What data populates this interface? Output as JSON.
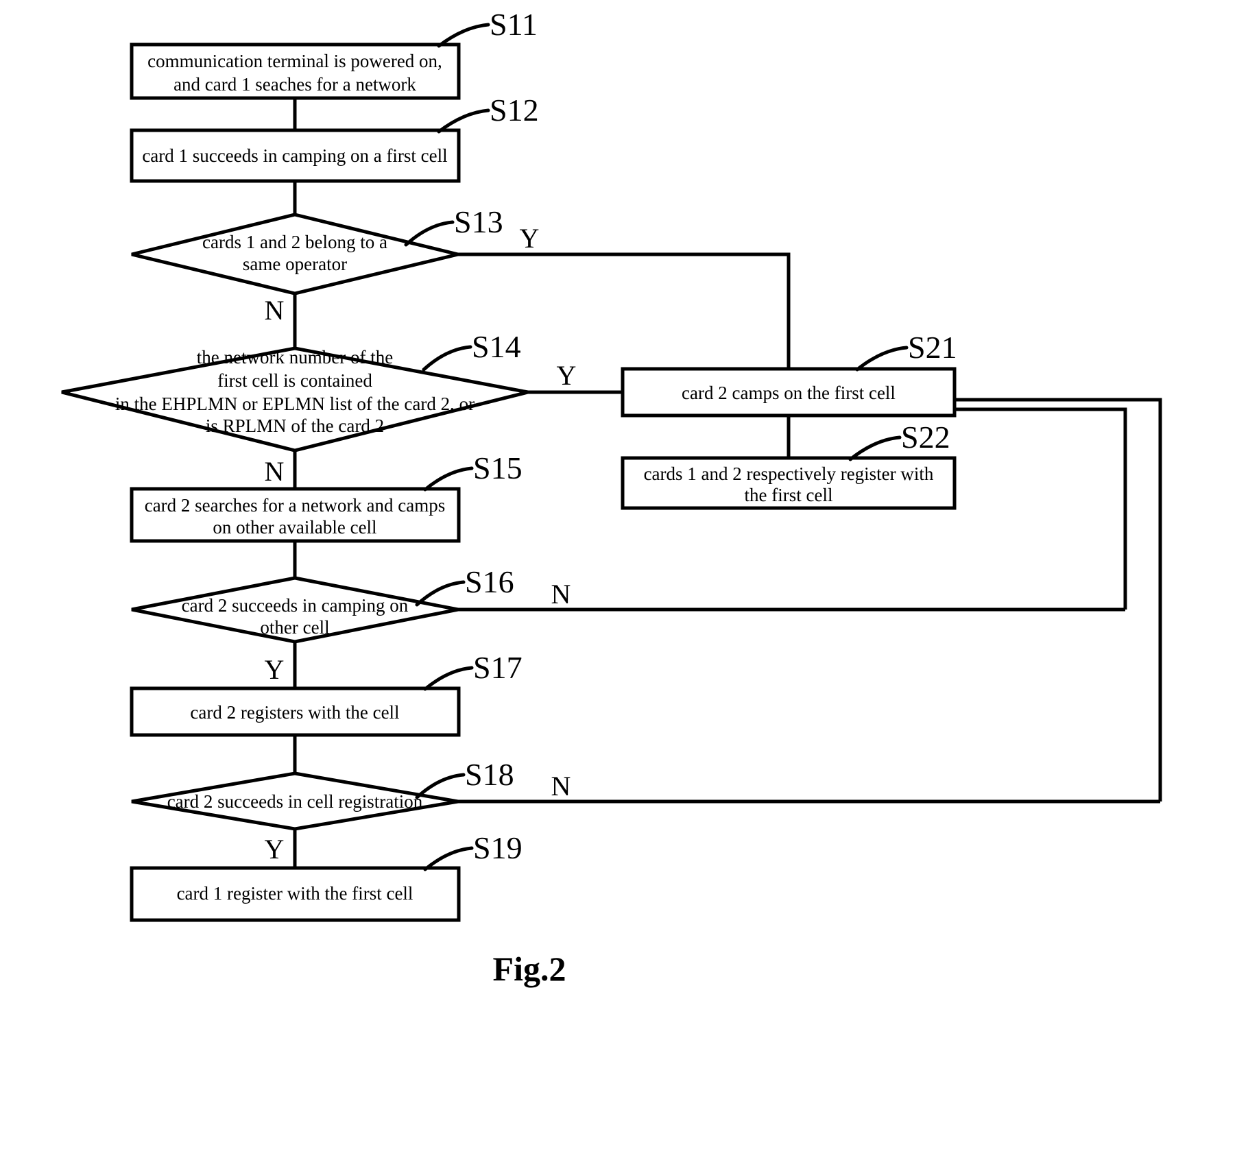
{
  "figure": {
    "caption": "Fig.2",
    "type": "flowchart"
  },
  "nodes": {
    "s11": {
      "id": "S11",
      "shape": "process",
      "lines": [
        "communication terminal is powered on,",
        "and card 1 seaches for a network"
      ]
    },
    "s12": {
      "id": "S12",
      "shape": "process",
      "lines": [
        "card 1 succeeds in camping on a first cell"
      ]
    },
    "s13": {
      "id": "S13",
      "shape": "decision",
      "lines": [
        "cards 1 and 2 belong to a",
        "same operator"
      ]
    },
    "s14": {
      "id": "S14",
      "shape": "decision",
      "lines": [
        "the network number of the",
        "first cell is contained",
        "in the EHPLMN or EPLMN list of the card 2, or",
        "is RPLMN of the card 2"
      ]
    },
    "s15": {
      "id": "S15",
      "shape": "process",
      "lines": [
        "card 2 searches for a network and camps",
        "on other available cell"
      ]
    },
    "s16": {
      "id": "S16",
      "shape": "decision",
      "lines": [
        "card 2 succeeds in camping on",
        "other cell"
      ]
    },
    "s17": {
      "id": "S17",
      "shape": "process",
      "lines": [
        "card 2 registers with the cell"
      ]
    },
    "s18": {
      "id": "S18",
      "shape": "decision",
      "lines": [
        "card 2 succeeds in  cell registration"
      ]
    },
    "s19": {
      "id": "S19",
      "shape": "process",
      "lines": [
        "card 1 register with the first cell"
      ]
    },
    "s21": {
      "id": "S21",
      "shape": "process",
      "lines": [
        "card 2 camps on the first cell"
      ]
    },
    "s22": {
      "id": "S22",
      "shape": "process",
      "lines": [
        "cards 1 and 2 respectively register with",
        "the first cell"
      ]
    }
  },
  "branch_labels": {
    "s13_yes": "Y",
    "s13_no": "N",
    "s14_yes": "Y",
    "s14_no": "N",
    "s16_no": "N",
    "s16_yes": "Y",
    "s18_no": "N",
    "s18_yes": "Y"
  },
  "colors": {
    "stroke": "#000000",
    "fill": "#ffffff",
    "background": "#ffffff"
  }
}
